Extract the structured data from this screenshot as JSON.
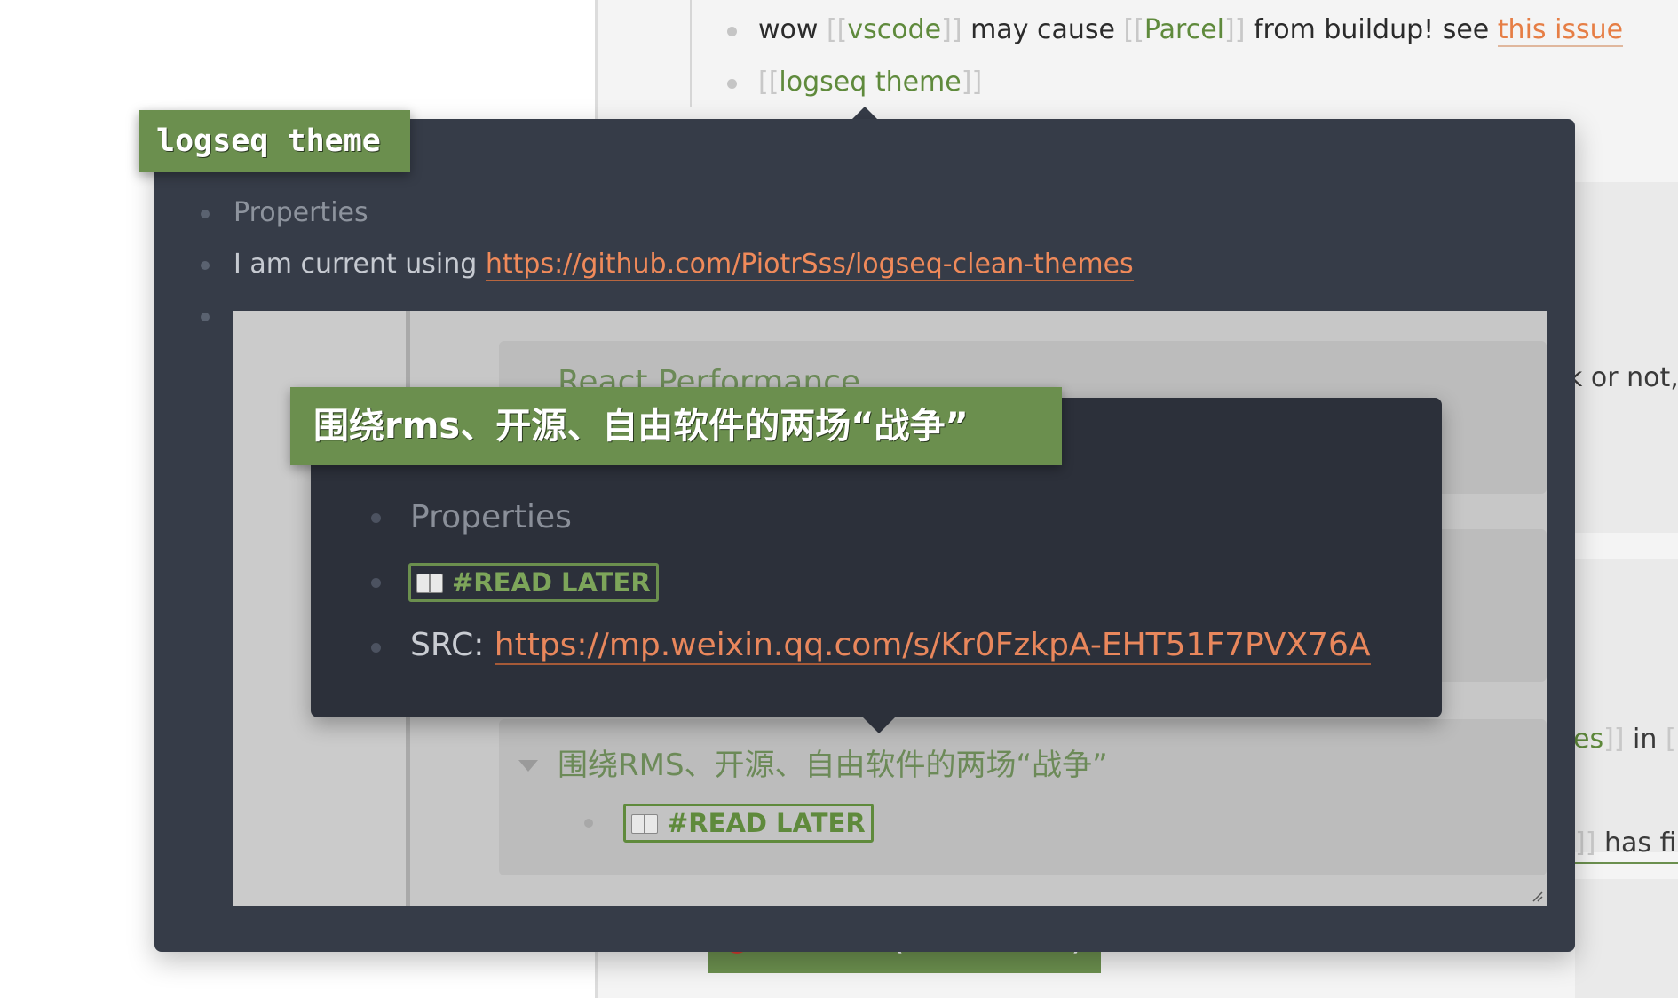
{
  "bg": {
    "line1": {
      "pre": "wow ",
      "link1": "vscode",
      "mid": " may cause ",
      "link2": "Parcel",
      "post": " from buildup! see ",
      "ext_link": "this issue"
    },
    "line2": {
      "link": "logseq theme"
    },
    "bracket_open": "[[",
    "bracket_close": "]]",
    "right_frag1": "k or not,",
    "right_frag2_link": "es",
    "right_frag2_text": " in ",
    "right_frag3": " has fini",
    "bottom_badge": "STALLED (in Journals)"
  },
  "popup1": {
    "title": "logseq theme",
    "properties_label": "Properties",
    "line2_text": "I am current using ",
    "line2_link": "https://github.com/PiotrSss/logseq-clean-themes"
  },
  "embed": {
    "card_title": "React Performance",
    "block_title": "围绕RMS、开源、自由软件的两场“战争”",
    "tag_label": "#READ LATER"
  },
  "popup2": {
    "title": "围绕rms、开源、自由软件的两场“战争”",
    "properties_label": "Properties",
    "tag_label": "#READ LATER",
    "src_label": "SRC: ",
    "src_link": "https://mp.weixin.qq.com/s/Kr0FzkpA-EHT51F7PVX76A"
  },
  "icons": {
    "book": "open-book-icon",
    "stop": "red-circle-icon",
    "collapse": "caret-down-icon"
  }
}
